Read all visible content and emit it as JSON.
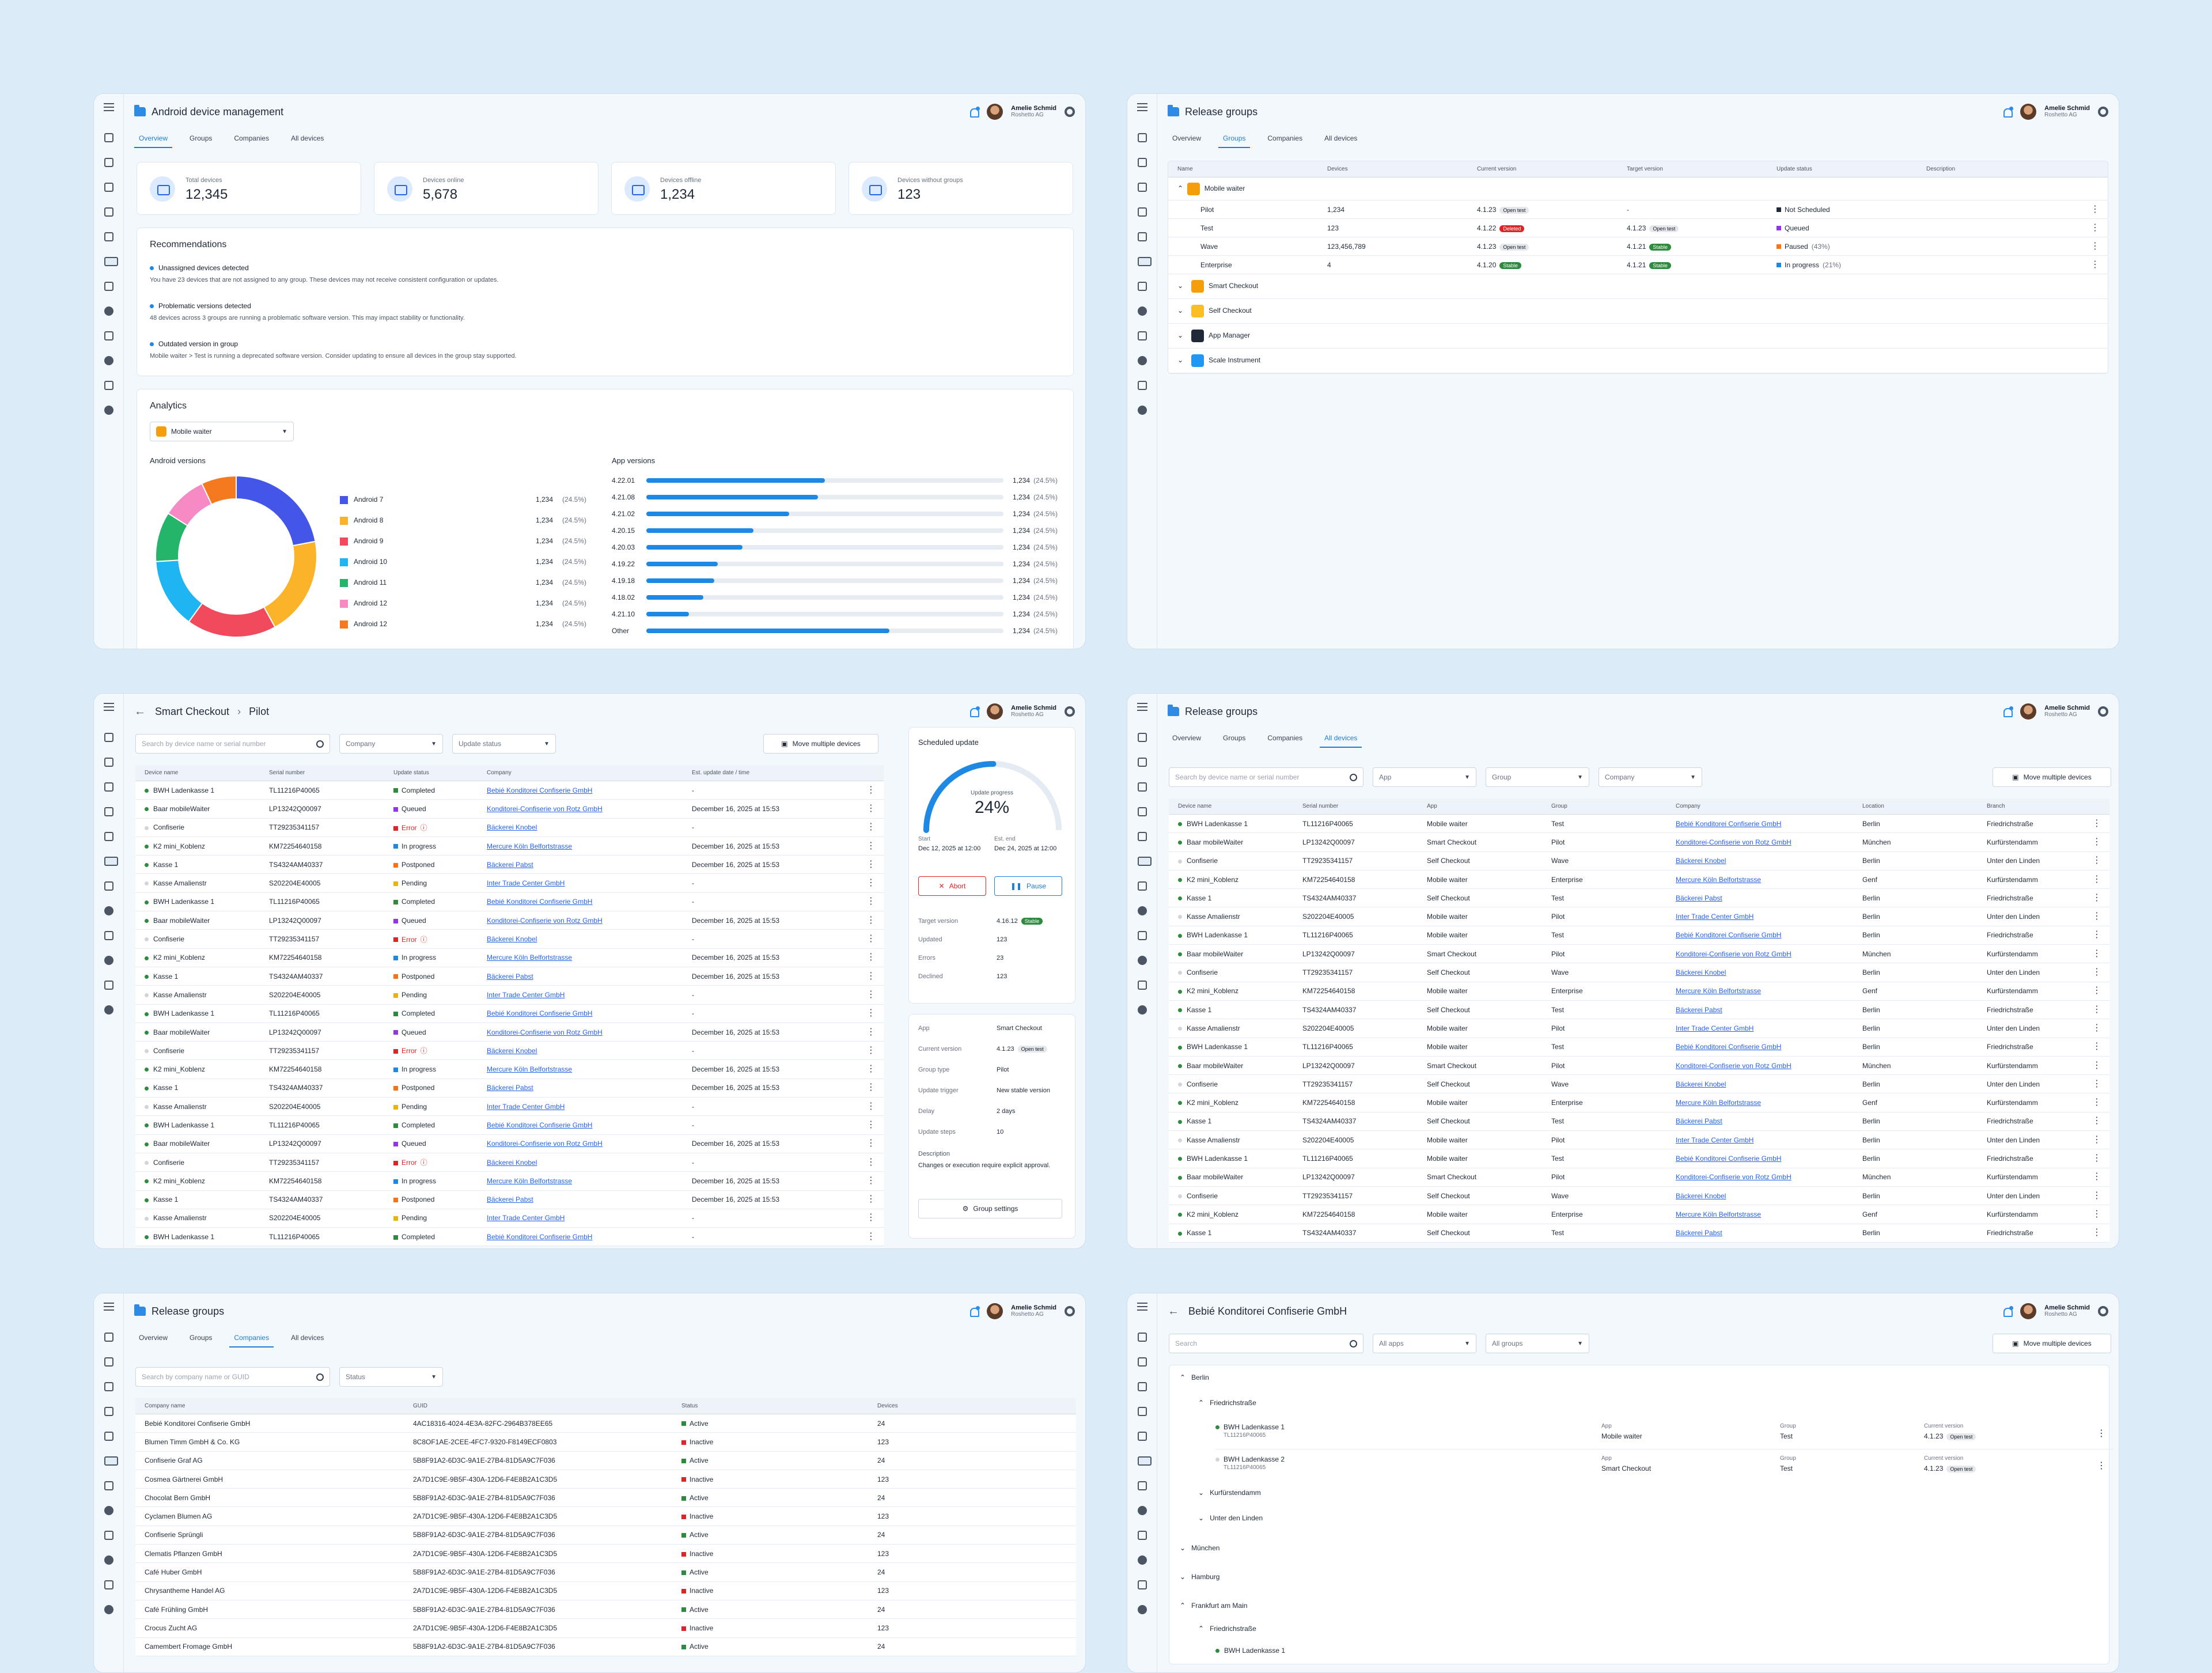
{
  "user": {
    "name": "Amelie Schmid",
    "company": "Roshetto AG"
  },
  "nav_tabs": [
    "Overview",
    "Groups",
    "Companies",
    "All devices"
  ],
  "p1": {
    "title": "Android device management",
    "stats": [
      {
        "label": "Total devices",
        "value": "12,345"
      },
      {
        "label": "Devices online",
        "value": "5,678"
      },
      {
        "label": "Devices offline",
        "value": "1,234"
      },
      {
        "label": "Devices without groups",
        "value": "123"
      }
    ],
    "rec_title": "Recommendations",
    "recs": [
      {
        "title": "Unassigned devices detected",
        "desc": "You have 23 devices that are not assigned to any group. These devices may not receive consistent configuration or updates."
      },
      {
        "title": "Problematic versions detected",
        "desc": "48 devices across 3 groups are running a problematic software version. This may impact stability or functionality."
      },
      {
        "title": "Outdated version in group",
        "desc": "Mobile waiter > Test is running a deprecated software version. Consider updating to ensure all devices in the group stay supported."
      }
    ],
    "analytics_title": "Analytics",
    "app_select": "Mobile waiter",
    "android_title": "Android versions",
    "app_title": "App versions",
    "android": [
      {
        "name": "Android 7",
        "value": "1,234",
        "pct": "(24.5%)",
        "color": "#4356e8",
        "share": 0.22
      },
      {
        "name": "Android 8",
        "value": "1,234",
        "pct": "(24.5%)",
        "color": "#fbb42a",
        "share": 0.2
      },
      {
        "name": "Android 9",
        "value": "1,234",
        "pct": "(24.5%)",
        "color": "#f04a5c",
        "share": 0.18
      },
      {
        "name": "Android 10",
        "value": "1,234",
        "pct": "(24.5%)",
        "color": "#1fb5f2",
        "share": 0.14
      },
      {
        "name": "Android 11",
        "value": "1,234",
        "pct": "(24.5%)",
        "color": "#24b56b",
        "share": 0.1
      },
      {
        "name": "Android 12",
        "value": "1,234",
        "pct": "(24.5%)",
        "color": "#f58ac4",
        "share": 0.09
      },
      {
        "name": "Android 12",
        "value": "1,234",
        "pct": "(24.5%)",
        "color": "#f57a1f",
        "share": 0.07
      }
    ],
    "appver": [
      {
        "name": "4.22.01",
        "value": "1,234",
        "pct": "(24.5%)",
        "fill": 0.5
      },
      {
        "name": "4.21.08",
        "value": "1,234",
        "pct": "(24.5%)",
        "fill": 0.48
      },
      {
        "name": "4.21.02",
        "value": "1,234",
        "pct": "(24.5%)",
        "fill": 0.4
      },
      {
        "name": "4.20.15",
        "value": "1,234",
        "pct": "(24.5%)",
        "fill": 0.3
      },
      {
        "name": "4.20.03",
        "value": "1,234",
        "pct": "(24.5%)",
        "fill": 0.27
      },
      {
        "name": "4.19.22",
        "value": "1,234",
        "pct": "(24.5%)",
        "fill": 0.2
      },
      {
        "name": "4.19.18",
        "value": "1,234",
        "pct": "(24.5%)",
        "fill": 0.19
      },
      {
        "name": "4.18.02",
        "value": "1,234",
        "pct": "(24.5%)",
        "fill": 0.16
      },
      {
        "name": "4.21.10",
        "value": "1,234",
        "pct": "(24.5%)",
        "fill": 0.12
      },
      {
        "name": "Other",
        "value": "1,234",
        "pct": "(24.5%)",
        "fill": 0.68
      }
    ]
  },
  "p2": {
    "title": "Release groups",
    "cols": [
      "Name",
      "Devices",
      "Current version",
      "Target version",
      "Update status",
      "Description"
    ],
    "group": "Mobile waiter",
    "rows": [
      {
        "name": "Pilot",
        "devices": "1,234",
        "cur": "4.1.23",
        "cur_badge": "Open test",
        "cur_bc": "",
        "tgt": "-",
        "tgt_badge": "",
        "tgt_bc": "",
        "status": "Not Scheduled",
        "sc": "#1f2937",
        "extra": ""
      },
      {
        "name": "Test",
        "devices": "123",
        "cur": "4.1.22",
        "cur_badge": "Deleted",
        "cur_bc": "red",
        "tgt": "4.1.23",
        "tgt_badge": "Open test",
        "tgt_bc": "",
        "status": "Queued",
        "sc": "#9333ea",
        "extra": ""
      },
      {
        "name": "Wave",
        "devices": "123,456,789",
        "cur": "4.1.23",
        "cur_badge": "Open test",
        "cur_bc": "",
        "tgt": "4.1.21",
        "tgt_badge": "Stable",
        "tgt_bc": "green",
        "status": "Paused",
        "sc": "#f97316",
        "extra": "(43%)"
      },
      {
        "name": "Enterprise",
        "devices": "4",
        "cur": "4.1.20",
        "cur_badge": "Stable",
        "cur_bc": "green",
        "tgt": "4.1.21",
        "tgt_badge": "Stable",
        "tgt_bc": "green",
        "status": "In progress",
        "sc": "#1e88e5",
        "extra": "(21%)"
      }
    ],
    "others": [
      {
        "name": "Smart Checkout",
        "color": "#f59e0b"
      },
      {
        "name": "Self Checkout",
        "color": "#fbbf24"
      },
      {
        "name": "App Manager",
        "color": "#1f2937"
      },
      {
        "name": "Scale Instrument",
        "color": "#2196f3"
      }
    ]
  },
  "p3": {
    "crumb1": "Smart Checkout",
    "crumb2": "Pilot",
    "search": "Search by device name or serial number",
    "company": "Company",
    "status": "Update status",
    "move": "Move multiple devices",
    "cols": [
      "Device name",
      "Serial number",
      "Update status",
      "Company",
      "Est. update date / time"
    ],
    "sched": {
      "title": "Scheduled update",
      "label": "Update progress",
      "pct": "24%",
      "progress": 0.24,
      "start_l": "Start",
      "start": "Dec 12, 2025 at 12:00",
      "end_l": "Est. end",
      "end": "Dec 24, 2025 at 12:00",
      "abort": "Abort",
      "pause": "Pause",
      "kv": [
        [
          "Target version",
          "4.16.12",
          "Stable"
        ],
        [
          "Updated",
          "123",
          ""
        ],
        [
          "Errors",
          "23",
          ""
        ],
        [
          "Declined",
          "123",
          ""
        ]
      ]
    },
    "info": [
      [
        "App",
        "Smart Checkout",
        ""
      ],
      [
        "Current version",
        "4.1.23",
        "Open test"
      ],
      [
        "Group type",
        "Pilot",
        ""
      ],
      [
        "Update trigger",
        "New stable version",
        ""
      ],
      [
        "Delay",
        "2 days",
        ""
      ],
      [
        "Update steps",
        "10",
        ""
      ]
    ],
    "desc_l": "Description",
    "desc": "Changes or execution require explicit approval.",
    "gs": "Group settings"
  },
  "devices": [
    {
      "n": "BWH Ladenkasse 1",
      "s": "TL11216P40065",
      "st": "Completed",
      "sc": "#2f8a3d",
      "co": "Bebié Konditorei Confiserie GmbH",
      "d": "-",
      "app": "Mobile waiter",
      "g": "Test",
      "loc": "Berlin",
      "br": "Friedrichstraße"
    },
    {
      "n": "Baar mobileWaiter",
      "s": "LP13242Q00097",
      "st": "Queued",
      "sc": "#9333ea",
      "co": "Konditorei-Confiserie von Rotz GmbH",
      "d": "December 16, 2025 at 15:53",
      "app": "Smart Checkout",
      "g": "Pilot",
      "loc": "München",
      "br": "Kurfürstendamm"
    },
    {
      "n": "Confiserie",
      "s": "TT29235341157",
      "st": "Error",
      "sc": "#dc2626",
      "co": "Bäckerei Knobel",
      "d": "-",
      "app": "Self Checkout",
      "g": "Wave",
      "loc": "Berlin",
      "br": "Unter den Linden"
    },
    {
      "n": "K2 mini_Koblenz",
      "s": "KM72254640158",
      "st": "In progress",
      "sc": "#1e88e5",
      "co": "Mercure Köln Belfortstrasse",
      "d": "December 16, 2025 at 15:53",
      "app": "Mobile waiter",
      "g": "Enterprise",
      "loc": "Genf",
      "br": "Kurfürstendamm"
    },
    {
      "n": "Kasse 1",
      "s": "TS4324AM40337",
      "st": "Postponed",
      "sc": "#f97316",
      "co": "Bäckerei Pabst",
      "d": "December 16, 2025 at 15:53",
      "app": "Self Checkout",
      "g": "Test",
      "loc": "Berlin",
      "br": "Friedrichstraße"
    },
    {
      "n": "Kasse Amalienstr",
      "s": "S202204E40005",
      "st": "Pending",
      "sc": "#eab308",
      "co": "Inter Trade Center GmbH",
      "d": "-",
      "app": "Mobile waiter",
      "g": "Pilot",
      "loc": "Berlin",
      "br": "Unter den Linden"
    }
  ],
  "p5": {
    "title": "Release groups",
    "search": "Search by company name or GUID",
    "status": "Status",
    "cols": [
      "Company name",
      "GUID",
      "Status",
      "Devices"
    ],
    "rows": [
      [
        "Bebié Konditorei Confiserie GmbH",
        "4AC18316-4024-4E3A-82FC-2964B378EE65",
        "Active",
        "24"
      ],
      [
        "Blumen Timm GmbH & Co. KG",
        "8C8OF1AE-2CEE-4FC7-9320-F8149ECF0803",
        "Inactive",
        "123"
      ],
      [
        "Confiserie Graf AG",
        "5B8F91A2-6D3C-9A1E-27B4-81D5A9C7F036",
        "Active",
        "24"
      ],
      [
        "Cosmea Gärtnerei GmbH",
        "2A7D1C9E-9B5F-430A-12D6-F4E8B2A1C3D5",
        "Inactive",
        "123"
      ],
      [
        "Chocolat Bern GmbH",
        "5B8F91A2-6D3C-9A1E-27B4-81D5A9C7F036",
        "Active",
        "24"
      ],
      [
        "Cyclamen Blumen AG",
        "2A7D1C9E-9B5F-430A-12D6-F4E8B2A1C3D5",
        "Inactive",
        "123"
      ],
      [
        "Confiserie Sprüngli",
        "5B8F91A2-6D3C-9A1E-27B4-81D5A9C7F036",
        "Active",
        "24"
      ],
      [
        "Clematis Pflanzen GmbH",
        "2A7D1C9E-9B5F-430A-12D6-F4E8B2A1C3D5",
        "Inactive",
        "123"
      ],
      [
        "Café Huber GmbH",
        "5B8F91A2-6D3C-9A1E-27B4-81D5A9C7F036",
        "Active",
        "24"
      ],
      [
        "Chrysantheme Handel AG",
        "2A7D1C9E-9B5F-430A-12D6-F4E8B2A1C3D5",
        "Inactive",
        "123"
      ],
      [
        "Café Frühling GmbH",
        "5B8F91A2-6D3C-9A1E-27B4-81D5A9C7F036",
        "Active",
        "24"
      ],
      [
        "Crocus Zucht AG",
        "2A7D1C9E-9B5F-430A-12D6-F4E8B2A1C3D5",
        "Inactive",
        "123"
      ],
      [
        "Camembert Fromage GmbH",
        "5B8F91A2-6D3C-9A1E-27B4-81D5A9C7F036",
        "Active",
        "24"
      ]
    ]
  },
  "p6": {
    "title": "Bebié Konditorei Confiserie GmbH",
    "search": "Search",
    "apps": "All apps",
    "groups": "All groups",
    "move": "Move multiple devices",
    "city1": "Berlin",
    "street1": "Friedrichstraße",
    "street2": "Kurfürstendamm",
    "street3": "Unter den Linden",
    "city2": "München",
    "city3": "Hamburg",
    "city4": "Frankfurt am Main",
    "street4": "Friedrichstraße",
    "dev": [
      {
        "n": "BWH Ladenkasse 1",
        "s": "TL11216P40065",
        "app": "Mobile waiter",
        "g": "Test",
        "v": "4.1.23",
        "b": "Open test",
        "on": true
      },
      {
        "n": "BWH Ladenkasse 2",
        "s": "TL11216P40065",
        "app": "Smart Checkout",
        "g": "Test",
        "v": "4.1.23",
        "b": "Open test",
        "on": false
      }
    ],
    "l_app": "App",
    "l_group": "Group",
    "l_cur": "Current version",
    "last": "BWH Ladenkasse 1"
  }
}
